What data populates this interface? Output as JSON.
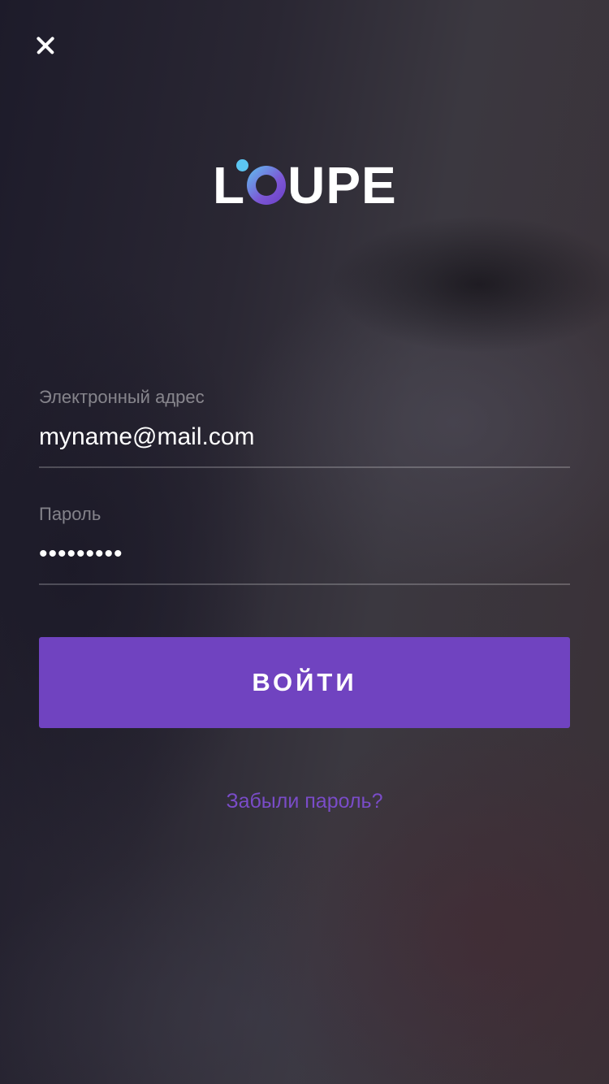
{
  "header": {
    "close_icon": "close-icon"
  },
  "logo": {
    "letter_l": "L",
    "letters_rest": "UPE"
  },
  "form": {
    "email": {
      "label": "Электронный адрес",
      "value": "myname@mail.com"
    },
    "password": {
      "label": "Пароль",
      "value": "•••••••••"
    },
    "submit_label": "ВОЙТИ",
    "forgot_label": "Забыли пароль?"
  },
  "colors": {
    "accent": "#7043c0",
    "link": "#7a4cc8",
    "logo_dot": "#5cc6f2"
  }
}
